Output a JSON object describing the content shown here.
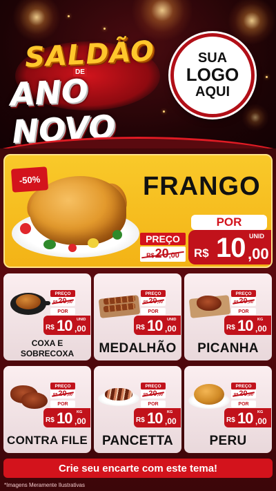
{
  "header": {
    "title_line1": "SALDÃO",
    "title_connector": "DE",
    "title_line2": "ANO NOVO",
    "logo_line1": "SUA",
    "logo_line2": "LOGO",
    "logo_line3": "AQUI"
  },
  "hero": {
    "discount": "-50%",
    "name": "FRANGO",
    "preco_label": "PREÇO",
    "old_currency": "R$",
    "old_int": "20",
    "old_cents": ",00",
    "por_label": "POR",
    "currency": "R$",
    "price_int": "10",
    "price_cents": ",00",
    "unit": "UNID"
  },
  "products": [
    {
      "name": "COXA E SOBRECOXA",
      "preco_label": "PREÇO",
      "old_currency": "R$",
      "old_int": "20",
      "old_cents": ",00",
      "por_label": "POR",
      "currency": "R$",
      "price_int": "10",
      "price_cents": ",00",
      "unit": "UNID"
    },
    {
      "name": "MEDALHÃO",
      "preco_label": "PREÇO",
      "old_currency": "R$",
      "old_int": "20",
      "old_cents": ",00",
      "por_label": "POR",
      "currency": "R$",
      "price_int": "10",
      "price_cents": ",00",
      "unit": "UNID"
    },
    {
      "name": "PICANHA",
      "preco_label": "PREÇO",
      "old_currency": "R$",
      "old_int": "20",
      "old_cents": ",00",
      "por_label": "POR",
      "currency": "R$",
      "price_int": "10",
      "price_cents": ",00",
      "unit": "KG"
    },
    {
      "name": "CONTRA FILE",
      "preco_label": "PREÇO",
      "old_currency": "R$",
      "old_int": "20",
      "old_cents": ",00",
      "por_label": "POR",
      "currency": "R$",
      "price_int": "10",
      "price_cents": ",00",
      "unit": "KG"
    },
    {
      "name": "PANCETTA",
      "preco_label": "PREÇO",
      "old_currency": "R$",
      "old_int": "20",
      "old_cents": ",00",
      "por_label": "POR",
      "currency": "R$",
      "price_int": "10",
      "price_cents": ",00",
      "unit": "KG"
    },
    {
      "name": "PERU",
      "preco_label": "PREÇO",
      "old_currency": "R$",
      "old_int": "20",
      "old_cents": ",00",
      "por_label": "POR",
      "currency": "R$",
      "price_int": "10",
      "price_cents": ",00",
      "unit": "KG"
    }
  ],
  "footer": {
    "cta": "Crie seu encarte com este tema!",
    "disclaimer": "*Imagens Meramente Ilustrativas"
  },
  "colors": {
    "brand_red": "#d3131c",
    "hero_yellow": "#f9c92a",
    "background_dark_red": "#3b0609"
  }
}
